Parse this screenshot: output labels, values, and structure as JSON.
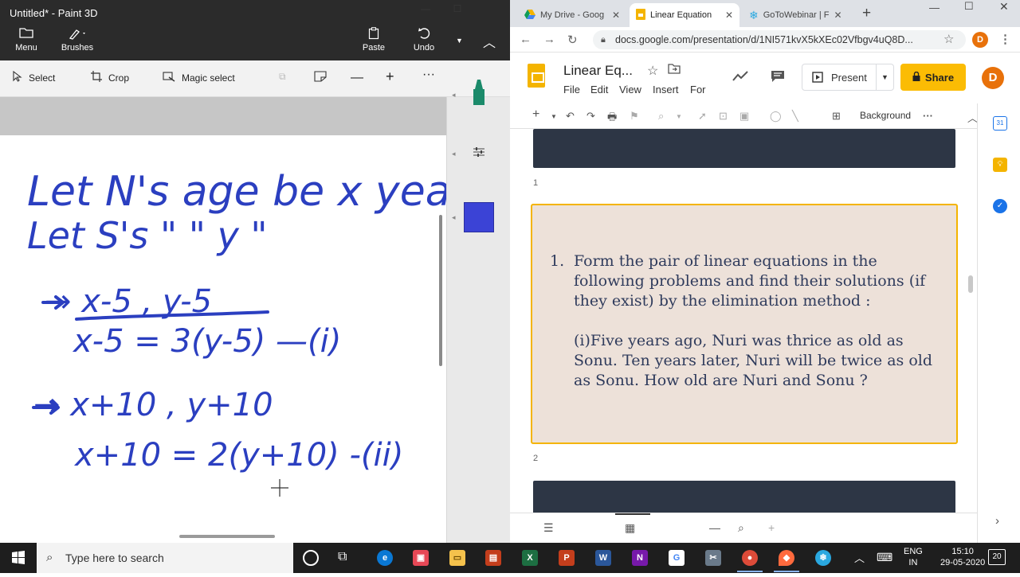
{
  "paint": {
    "window_title": "Untitled* - Paint 3D",
    "menu_label": "Menu",
    "brushes_label": "Brushes",
    "paste_label": "Paste",
    "undo_label": "Undo",
    "tools": {
      "select": "Select",
      "crop": "Crop",
      "magic_select": "Magic select"
    },
    "selected_color": "#3b43d6",
    "ink_color": "#2b3fc0",
    "handwriting": [
      "Let N's age be x years",
      "Let S's \" \" y \"",
      "→ x-5 , y-5",
      "x-5 = 3(y-5) —(i)",
      "→ x+10 , y+10",
      "x+10 = 2(y+10) -(ii)"
    ]
  },
  "chrome": {
    "tabs": [
      {
        "label": "My Drive - Goog",
        "active": false
      },
      {
        "label": "Linear Equation",
        "active": true
      },
      {
        "label": "GoToWebinar | F",
        "active": false
      }
    ],
    "url": "docs.google.com/presentation/d/1NI571kvX5kXEc02Vfbgv4uQ8D...",
    "profile_initial": "D"
  },
  "slides": {
    "doc_title": "Linear Eq...",
    "menu": [
      "File",
      "Edit",
      "View",
      "Insert",
      "For"
    ],
    "present_label": "Present",
    "share_label": "Share",
    "background_label": "Background",
    "slide_numbers": [
      "1",
      "2"
    ],
    "slide2": {
      "number": "1.",
      "paragraph1": "Form the pair of linear equations in the following problems and find their solutions (if they exist) by the elimination method :",
      "paragraph2": "(i)Five years ago, Nuri was thrice as old as Sonu. Ten years later, Nuri will be twice as old as Sonu. How old are Nuri and Sonu ?"
    }
  },
  "taskbar": {
    "search_placeholder": "Type here to search",
    "lang_line1": "ENG",
    "lang_line2": "IN",
    "time": "15:10",
    "date": "29-05-2020",
    "notification_count": "20"
  }
}
